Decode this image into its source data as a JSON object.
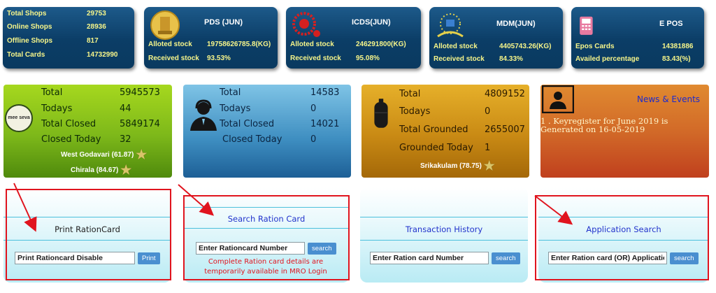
{
  "shops_card": {
    "rows": [
      {
        "label": "Total Shops",
        "value": "29753"
      },
      {
        "label": "Online Shops",
        "value": "28936"
      },
      {
        "label": "Offline Shops",
        "value": "817"
      },
      {
        "label": "Total Cards",
        "value": "14732990"
      }
    ]
  },
  "pds_card": {
    "title": "PDS (JUN)",
    "alloted_label": "Alloted stock",
    "alloted_value": "19758626785.8(KG)",
    "received_label": "Received stock",
    "received_value": "93.53%"
  },
  "icds_card": {
    "title": "ICDS(JUN)",
    "alloted_label": "Alloted stock",
    "alloted_value": "246291800(KG)",
    "received_label": "Received stock",
    "received_value": "95.08%"
  },
  "mdm_card": {
    "title": "MDM(JUN)",
    "alloted_label": "Alloted stock",
    "alloted_value": "4405743.26(KG)",
    "received_label": "Received stock",
    "received_value": "84.33%"
  },
  "epos_card": {
    "title": "E POS",
    "cards_label": "Epos Cards",
    "cards_value": "14381886",
    "availed_label": "Availed percentage",
    "availed_value": "83.43(%)"
  },
  "meeseva_panel": {
    "logo_text": "mee seva",
    "rows": [
      {
        "label": "Total",
        "value": "5945573"
      },
      {
        "label": "Todays",
        "value": "44"
      },
      {
        "label": "Total Closed",
        "value": "5849174"
      },
      {
        "label": "Closed Today",
        "value": "32"
      }
    ],
    "top1": "West Godavari  (61.87)",
    "top2": "Chirala  (84.67)"
  },
  "grievance_panel": {
    "rows": [
      {
        "label": "Total",
        "value": "14583"
      },
      {
        "label": "Todays",
        "value": "0"
      },
      {
        "label": "Total Closed",
        "value": "14021"
      },
      {
        "label": "Closed Today",
        "value": "0"
      }
    ]
  },
  "gas_panel": {
    "rows": [
      {
        "label": "Total",
        "value": "4809152"
      },
      {
        "label": "Todays",
        "value": "0"
      },
      {
        "label": "Total Grounded",
        "value": "2655007"
      },
      {
        "label": "Grounded Today",
        "value": "1"
      }
    ],
    "top1": "Srikakulam  (78.75)"
  },
  "news_panel": {
    "title": "News & Events",
    "item": "1 . Keyregister for June 2019 is Generated on 16-05-2019"
  },
  "print_panel": {
    "title": "Print RationCard",
    "input_value": "Print Rationcard Disable",
    "button": "Print"
  },
  "search_panel": {
    "title": "Search Ration Card",
    "placeholder": "Enter Rationcard Number",
    "button": "search",
    "note": "Complete Ration card details are temporarily available in MRO Login"
  },
  "transaction_panel": {
    "title": "Transaction History",
    "placeholder": "Enter Ration card Number",
    "button": "search"
  },
  "application_panel": {
    "title": "Application Search",
    "placeholder": "Enter Ration card (OR) Application",
    "button": "search"
  },
  "colors": {
    "highlight_red": "#e0141e",
    "card_text_yellow": "#f6f58a"
  }
}
